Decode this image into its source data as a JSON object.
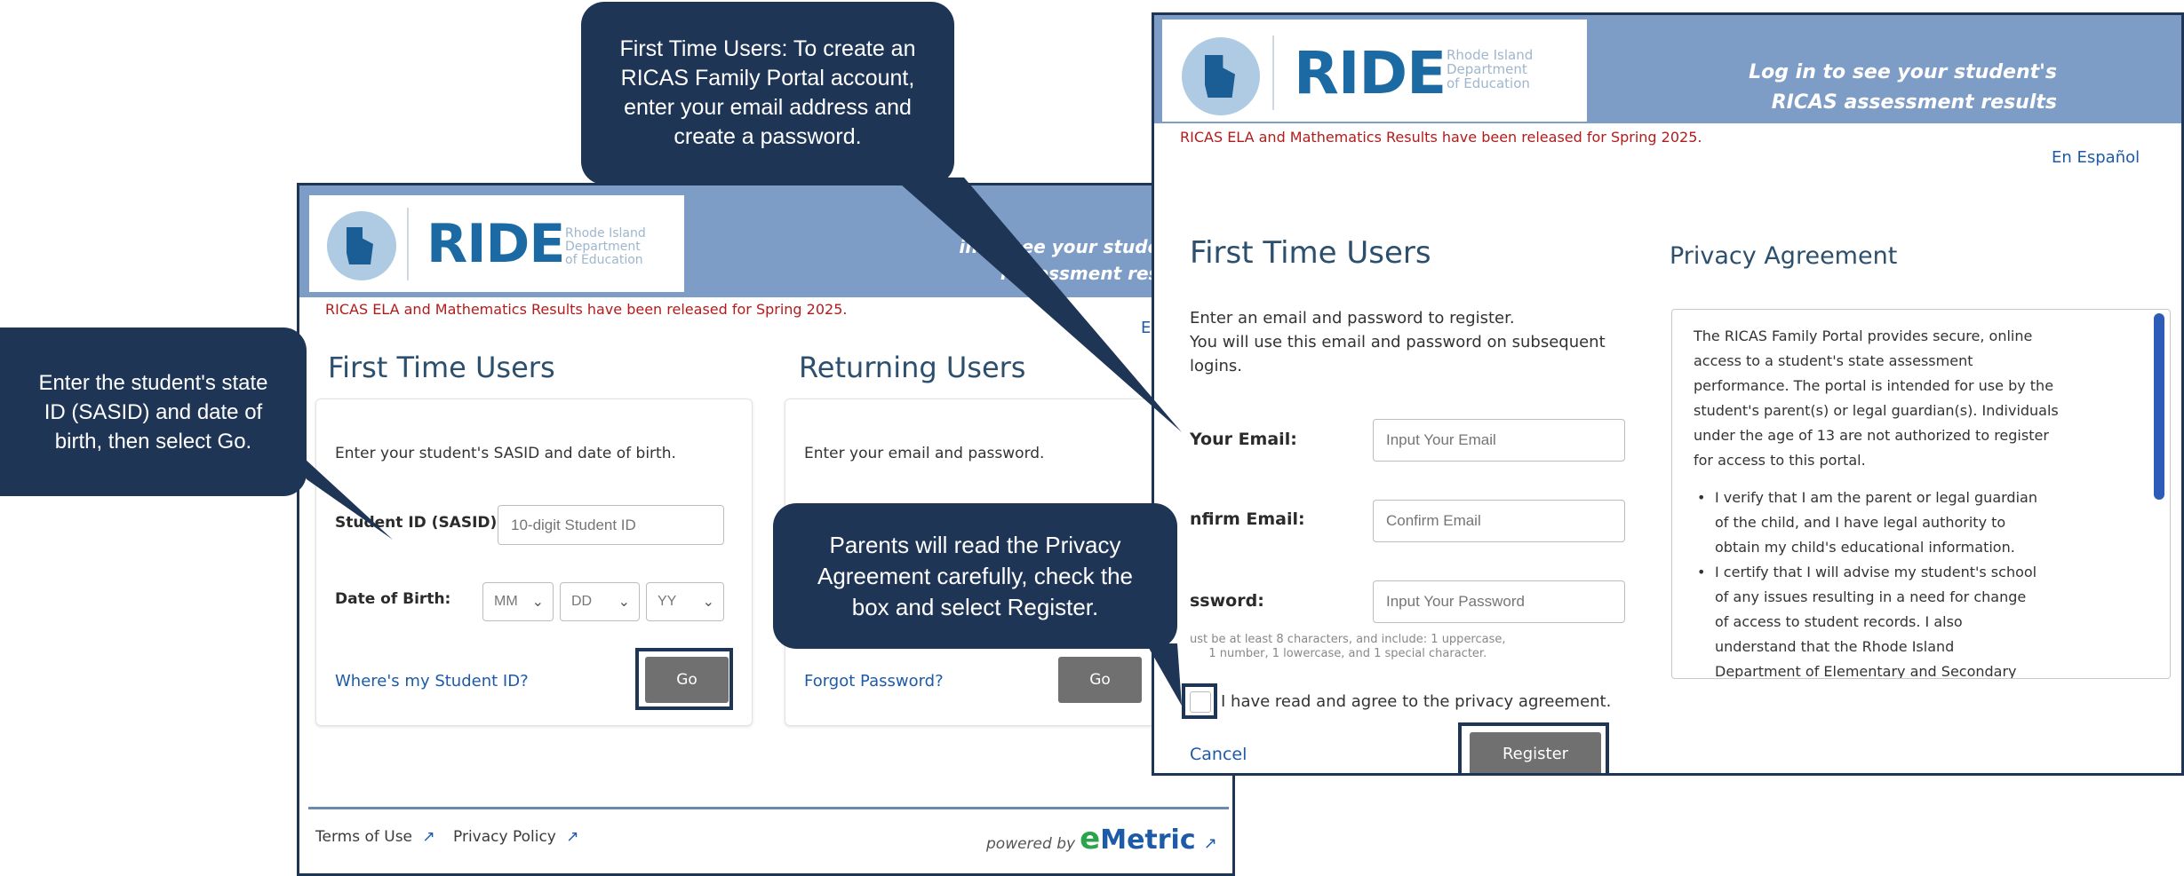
{
  "brand": {
    "logo_word": "RIDE",
    "logo_sub": [
      "Rhode Island",
      "Department",
      "of Education"
    ],
    "primary_color": "#1b6aa3",
    "banner_color": "#7e9dc6",
    "callout_color": "#1f3556",
    "alert_color": "#b31b1b"
  },
  "left_screen": {
    "tagline": [
      "in to see your student's",
      "r  ssessment results"
    ],
    "release_notice": "RICAS ELA and Mathematics Results have been released for Spring 2025.",
    "lang_fragment": "E",
    "first_time": {
      "title": "First Time Users",
      "instruction": "Enter your student's SASID and date of birth.",
      "sasid_label": "Student ID (SASID):",
      "sasid_placeholder": "10-digit Student ID",
      "dob_label": "Date of Birth:",
      "dob_month": "MM",
      "dob_day": "DD",
      "dob_year": "YY",
      "help_link": "Where's my Student ID?",
      "go_label": "Go"
    },
    "returning": {
      "title": "Returning Users",
      "instruction": "Enter your email and password.",
      "forgot_link": "Forgot Password?",
      "go_label": "Go"
    },
    "footer": {
      "terms": "Terms of Use",
      "privacy": "Privacy Policy",
      "powered_by": "powered by",
      "vendor_e": "e",
      "vendor_rest": "Metric"
    }
  },
  "right_screen": {
    "tagline": [
      "Log in to see your student's",
      "RICAS assessment results"
    ],
    "release_notice": "RICAS ELA and Mathematics Results have been released for Spring 2025.",
    "language_link": "En Español",
    "first_time": {
      "title": "First Time Users",
      "instruction_lines": [
        "Enter an email and password to register.",
        "You will use this email and password on subsequent",
        "logins."
      ],
      "email_label": "Your Email:",
      "email_placeholder": "Input Your Email",
      "confirm_label": "nfirm Email:",
      "confirm_placeholder": "Confirm Email",
      "password_label": "ssword:",
      "password_placeholder": "Input Your Password",
      "password_hint": [
        "ust be at least 8 characters, and include: 1 uppercase,",
        "1 number, 1 lowercase, and 1 special character."
      ],
      "agree_label": "I have read and agree to the privacy agreement.",
      "cancel_label": "Cancel",
      "register_label": "Register"
    },
    "privacy": {
      "title": "Privacy Agreement",
      "intro_lines": [
        "The RICAS Family Portal provides secure, online",
        "access to a student's state assessment",
        "performance. The portal is intended for use by the",
        "student's parent(s) or legal guardian(s). Individuals",
        "under the age of 13 are not authorized to register",
        "for access to this portal."
      ],
      "bullets": [
        [
          "I verify that I am the parent or legal guardian",
          "of the child, and I have legal authority to",
          "obtain my child's educational information."
        ],
        [
          "I certify that I will advise my student's school",
          "of any issues resulting in a need for change",
          "of access to student records. I also",
          "understand that the Rhode Island",
          "Department of Elementary and Secondary"
        ]
      ]
    }
  },
  "callouts": {
    "first_time": [
      "First Time Users: To create an",
      "RICAS Family Portal account,",
      "enter your email address and",
      "create a password."
    ],
    "sasid": [
      "Enter the student's state",
      "ID (SASID) and date of",
      "birth, then select Go."
    ],
    "privacy": [
      "Parents will read the Privacy",
      "Agreement carefully, check the",
      "box and select Register."
    ]
  }
}
